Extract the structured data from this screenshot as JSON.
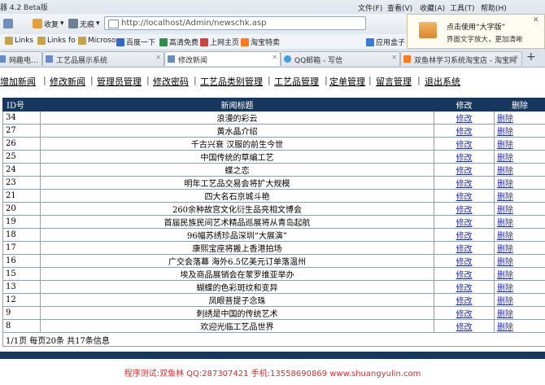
{
  "browser": {
    "title": "器 4.2 Beta版",
    "menus": [
      "文件(F)",
      "查看(V)",
      "收藏(A)",
      "工具(T)",
      "帮助(H)"
    ],
    "toolbar": {
      "back": "收复",
      "no_tab": "无痕"
    },
    "address": "http://localhost/Admin/newschk.asp",
    "bookmarks": [
      "Links",
      "Links fo",
      "Microso",
      "百度一下",
      "高清免费",
      "上网主页",
      "淘宝特卖",
      "应用盒子"
    ],
    "tabs": [
      {
        "label": "网趣电…"
      },
      {
        "label": "工艺品展示系统"
      },
      {
        "label": "修改新闻"
      },
      {
        "label": "QQ邮箱 - 写信"
      },
      {
        "label": "双鱼林学习系统淘宝店 - 淘宝网"
      }
    ],
    "popup": {
      "title": "点击使用“大字版”",
      "subtitle": "界面文字放大，更加清晰"
    }
  },
  "nav": [
    "增加新闻",
    "修改新闻",
    "管理员管理",
    "修改密码",
    "工艺品类别管理",
    "工艺品管理",
    "定单管理",
    "留言管理",
    "退出系统"
  ],
  "table": {
    "headers": {
      "id": "ID号",
      "title": "新闻标题",
      "edit": "修改",
      "delete": "删除"
    },
    "rows": [
      {
        "id": "34",
        "title": "浪漫的彩云",
        "edit": "修改",
        "delete": "删除"
      },
      {
        "id": "27",
        "title": "黄水晶介绍",
        "edit": "修改",
        "delete": "删除"
      },
      {
        "id": "26",
        "title": "千古兴衰 汉服的前生今世",
        "edit": "修改",
        "delete": "删除"
      },
      {
        "id": "25",
        "title": "中国传统的草编工艺",
        "edit": "修改",
        "delete": "删除"
      },
      {
        "id": "24",
        "title": "蝶之恋",
        "edit": "修改",
        "delete": "删除"
      },
      {
        "id": "23",
        "title": "明年工艺品交易会将扩大规模",
        "edit": "修改",
        "delete": "删除"
      },
      {
        "id": "21",
        "title": "四大名石京城斗艳",
        "edit": "修改",
        "delete": "删除"
      },
      {
        "id": "20",
        "title": "260余种故宫文化衍生品亮相文博会",
        "edit": "修改",
        "delete": "删除"
      },
      {
        "id": "19",
        "title": "首届民族民间艺术精品巡展将从青岛起航",
        "edit": "修改",
        "delete": "删除"
      },
      {
        "id": "18",
        "title": "96幅苏绣珍品深圳“大展演”",
        "edit": "修改",
        "delete": "删除"
      },
      {
        "id": "17",
        "title": "康熙宝座将搬上香港拍场",
        "edit": "修改",
        "delete": "删除"
      },
      {
        "id": "16",
        "title": "广交会落幕 海外6.5亿美元订单落温州",
        "edit": "修改",
        "delete": "删除"
      },
      {
        "id": "15",
        "title": "埃及商品展销会在蒙罗维亚举办",
        "edit": "修改",
        "delete": "删除"
      },
      {
        "id": "13",
        "title": "蝴蝶的色彩斑纹和变异",
        "edit": "修改",
        "delete": "删除"
      },
      {
        "id": "12",
        "title": "凤眼菩提子念珠",
        "edit": "修改",
        "delete": "删除"
      },
      {
        "id": "9",
        "title": "刺绣是中国的传统艺术",
        "edit": "修改",
        "delete": "删除"
      },
      {
        "id": "8",
        "title": "欢迎光临工艺品世界",
        "edit": "修改",
        "delete": "删除"
      }
    ],
    "pager": "1/1页  每页20条  共17条信息"
  },
  "footer": "程序测试:双鱼林 QQ:287307421 手机:13558690869 www.shuangyulin.com",
  "colors": {
    "header_bg": "#17375e",
    "link": "#2a2f9e",
    "footer_text": "#d62e2e"
  }
}
